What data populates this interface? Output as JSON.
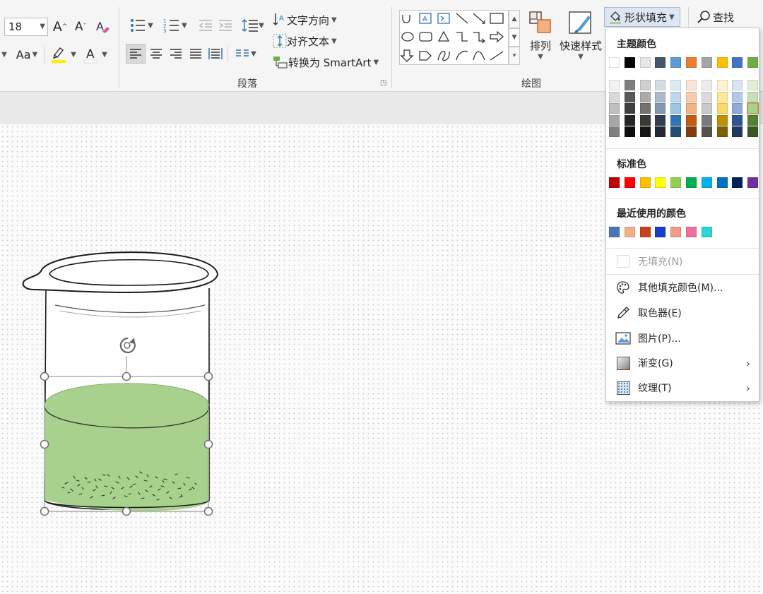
{
  "ribbon": {
    "font_size": "18",
    "labels": {
      "grow_font": "A",
      "shrink_font": "A",
      "change_case": "Aa",
      "font_color": "A"
    },
    "paragraph": {
      "text_direction": "文字方向",
      "align_text": "对齐文本",
      "convert_smartart": "转换为 SmartArt",
      "group_label": "段落"
    },
    "drawing": {
      "arrange": "排列",
      "quick_styles": "快速样式",
      "shape_fill": "形状填充",
      "group_label": "绘图"
    },
    "find": "查找"
  },
  "fill_menu": {
    "theme_header": "主题颜色",
    "theme_top_row": [
      "#ffffff",
      "#000000",
      "#e7e6e6",
      "#44546a",
      "#5b9bd5",
      "#ed7d31",
      "#a5a5a5",
      "#ffc000",
      "#4472c4",
      "#70ad47"
    ],
    "theme_shades": [
      [
        "#f2f2f2",
        "#d9d9d9",
        "#bfbfbf",
        "#a6a6a6",
        "#808080"
      ],
      [
        "#7f7f7f",
        "#595959",
        "#3f3f3f",
        "#262626",
        "#0d0d0d"
      ],
      [
        "#d0cece",
        "#aeaaaa",
        "#757070",
        "#3a3838",
        "#171616"
      ],
      [
        "#d6dce4",
        "#adb9ca",
        "#8497b0",
        "#333f4f",
        "#222a35"
      ],
      [
        "#deebf7",
        "#bdd7ee",
        "#9dc3e6",
        "#2e75b6",
        "#1f4e79"
      ],
      [
        "#fbe5d6",
        "#f8cbad",
        "#f4b183",
        "#c55a11",
        "#843c0c"
      ],
      [
        "#ededed",
        "#dbdbdb",
        "#c9c9c9",
        "#7b7b7b",
        "#525252"
      ],
      [
        "#fff2cc",
        "#ffe699",
        "#ffd966",
        "#bf9000",
        "#7f6000"
      ],
      [
        "#dae3f3",
        "#b4c7e7",
        "#8faadc",
        "#2f5597",
        "#203864"
      ],
      [
        "#e2f0d9",
        "#c5e0b4",
        "#a9d18e",
        "#548235",
        "#385723"
      ]
    ],
    "standard_header": "标准色",
    "standard": [
      "#c00000",
      "#ff0000",
      "#ffc000",
      "#ffff00",
      "#92d050",
      "#00b050",
      "#00b0f0",
      "#0070c0",
      "#002060",
      "#7030a0"
    ],
    "recent_header": "最近使用的颜色",
    "recent": [
      "#4a76b5",
      "#f0b18a",
      "#c8431d",
      "#1c3cc8",
      "#f59a8a",
      "#ef6f9a",
      "#2ad6d6"
    ],
    "no_fill": "无填充(N)",
    "more_colors": "其他填充颜色(M)...",
    "eyedropper": "取色器(E)",
    "picture": "图片(P)...",
    "gradient": "渐变(G)",
    "texture": "纹理(T)"
  },
  "colors": {
    "liquid": "#a9d18e",
    "selected_swatch": "#a9d18e"
  }
}
